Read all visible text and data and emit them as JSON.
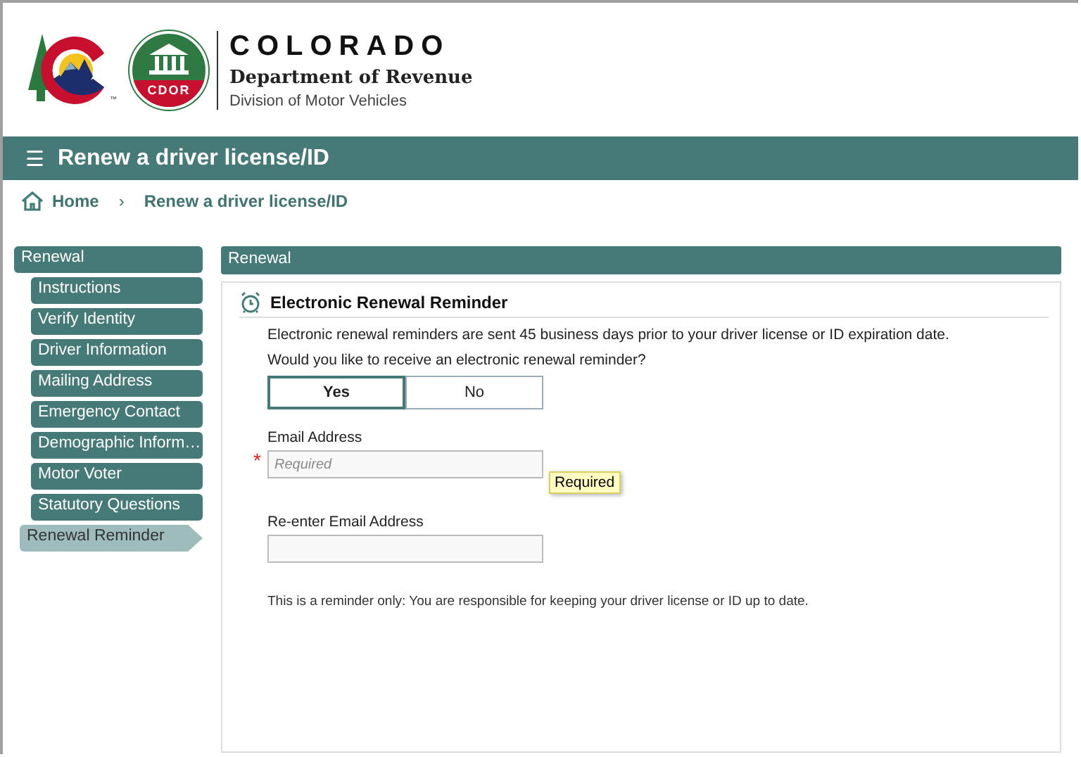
{
  "header": {
    "logo_text": "CDOR",
    "trademark": "™",
    "title": "COLORADO",
    "department": "Department of Revenue",
    "division": "Division of Motor Vehicles"
  },
  "title_bar": {
    "menu_glyph": "☰",
    "title": "Renew a driver license/ID"
  },
  "breadcrumb": [
    {
      "label": "Home"
    },
    {
      "label": "Renew a driver license/ID"
    }
  ],
  "breadcrumb_separator": "›",
  "sidebar": {
    "group": "Renewal",
    "items": [
      {
        "label": "Instructions",
        "selected": false
      },
      {
        "label": "Verify Identity",
        "selected": false
      },
      {
        "label": "Driver Information",
        "selected": false
      },
      {
        "label": "Mailing Address",
        "selected": false
      },
      {
        "label": "Emergency Contact",
        "selected": false
      },
      {
        "label": "Demographic Inform…",
        "selected": false
      },
      {
        "label": "Motor Voter",
        "selected": false
      },
      {
        "label": "Statutory Questions",
        "selected": false
      },
      {
        "label": "Renewal Reminder",
        "selected": true
      }
    ]
  },
  "panel": {
    "title": "Renewal",
    "section_title": "Electronic Renewal Reminder",
    "info": "Electronic renewal reminders are sent 45 business days prior to your driver license or ID expiration date.",
    "question": "Would you like to receive an electronic renewal reminder?",
    "options": [
      {
        "label": "Yes",
        "selected": true
      },
      {
        "label": "No",
        "selected": false
      }
    ],
    "fields": [
      {
        "label": "Email Address",
        "required_mark": "*",
        "placeholder": "Required",
        "tooltip": "Required"
      },
      {
        "label": "Re-enter Email Address"
      }
    ],
    "note": "This is a reminder only: You are responsible for keeping your driver license or ID up to date."
  }
}
